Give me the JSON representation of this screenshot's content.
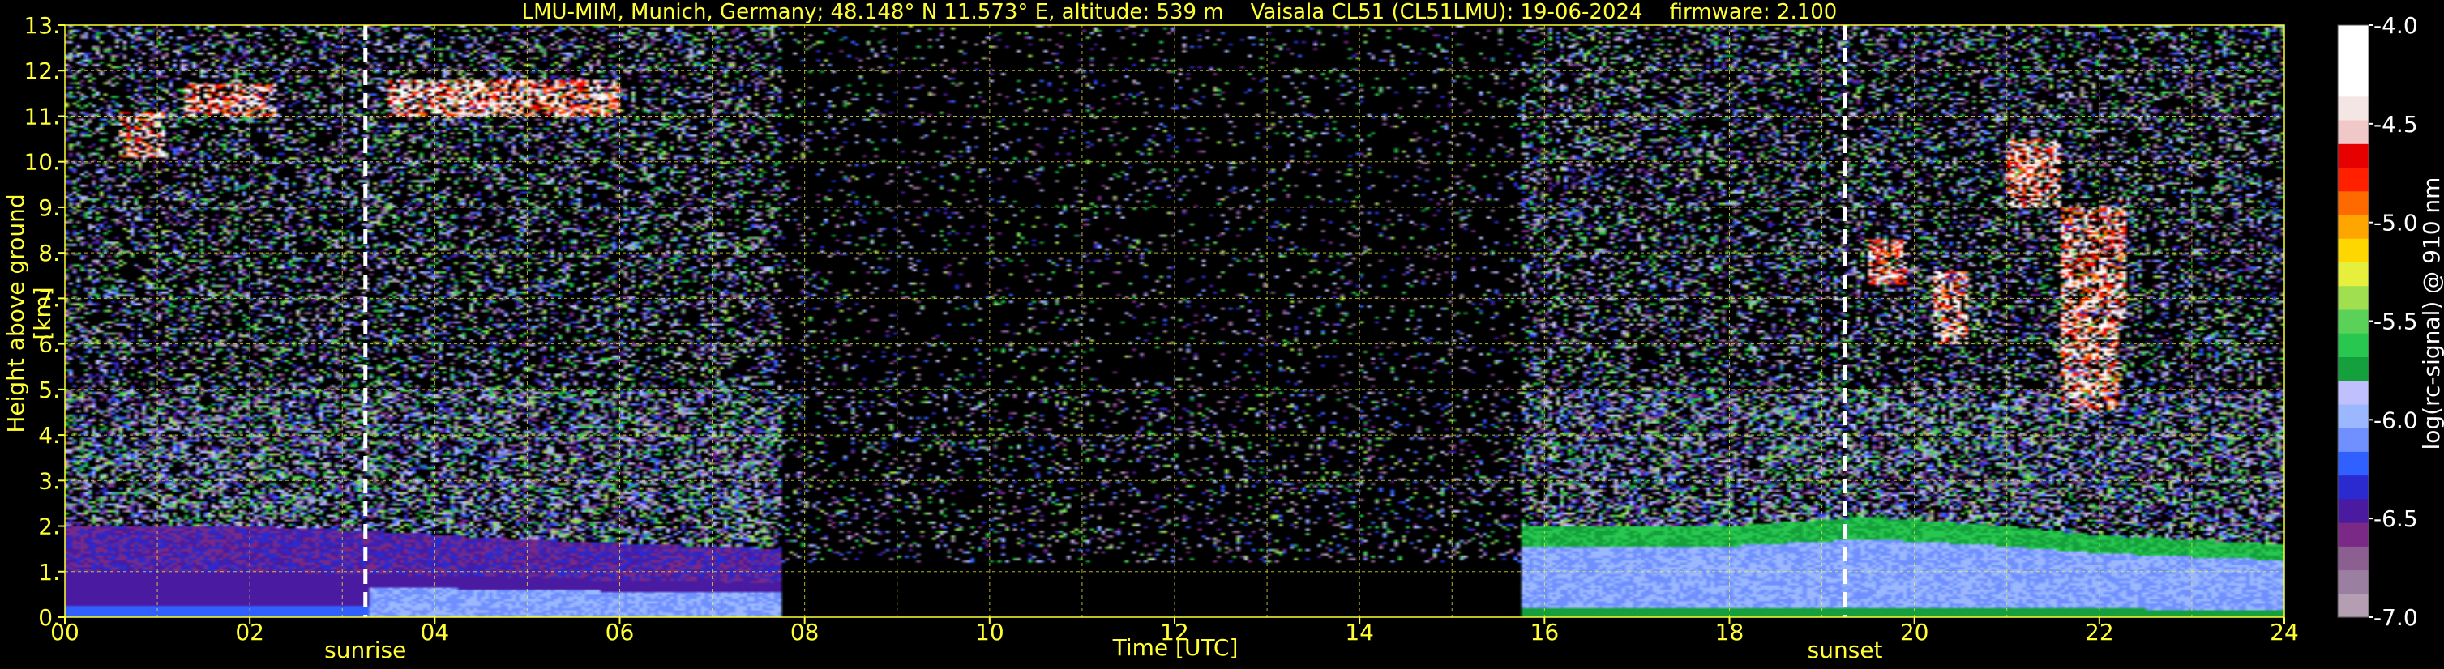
{
  "chart_data": {
    "type": "heatmap",
    "title": "LMU-MIM, Munich, Germany; 48.148° N 11.573° E, altitude: 539 m    Vaisala CL51 (CL51LMU): 19-06-2024    firmware: 2.100",
    "xlabel": "Time [UTC]",
    "ylabel": "Height above ground [km]",
    "xlim": [
      0,
      24
    ],
    "ylim": [
      0,
      13
    ],
    "x_ticks": [
      "00",
      "02",
      "04",
      "06",
      "08",
      "10",
      "12",
      "14",
      "16",
      "18",
      "20",
      "22",
      "24"
    ],
    "y_ticks": [
      "0.",
      "1.",
      "2.",
      "3.",
      "4.",
      "5.",
      "6.",
      "7.",
      "8.",
      "9.",
      "10.",
      "11.",
      "12.",
      "13."
    ],
    "grid": true,
    "colorbar": {
      "label": "log(rc-signal) @ 910 nm",
      "range": [
        -7.0,
        -4.0
      ],
      "ticks": [
        "-4.0",
        "-4.5",
        "-5.0",
        "-5.5",
        "-6.0",
        "-6.5",
        "-7.0"
      ]
    },
    "annotations": [
      {
        "label": "sunrise",
        "x": 3.25
      },
      {
        "label": "sunset",
        "x": 19.25
      }
    ],
    "missing_data_interval": [
      7.75,
      15.75
    ],
    "features": {
      "boundary_layer_top_km": [
        [
          0,
          2.0
        ],
        [
          2,
          2.0
        ],
        [
          3.25,
          1.9
        ],
        [
          5,
          1.7
        ],
        [
          7.7,
          1.5
        ],
        [
          15.8,
          2.0
        ],
        [
          18,
          2.0
        ],
        [
          19.5,
          2.2
        ],
        [
          21,
          2.0
        ],
        [
          22,
          1.8
        ],
        [
          23,
          1.7
        ],
        [
          24,
          1.6
        ]
      ],
      "cirrus_segments": [
        {
          "t0": 0.6,
          "t1": 1.1,
          "z0": 10.1,
          "z1": 11.1
        },
        {
          "t0": 1.3,
          "t1": 2.3,
          "z0": 11.0,
          "z1": 11.7
        },
        {
          "t0": 3.5,
          "t1": 6.0,
          "z0": 11.0,
          "z1": 11.8
        },
        {
          "t0": 19.5,
          "t1": 19.9,
          "z0": 7.3,
          "z1": 8.3
        },
        {
          "t0": 20.2,
          "t1": 20.6,
          "z0": 6.0,
          "z1": 7.6
        },
        {
          "t0": 21.0,
          "t1": 21.6,
          "z0": 9.0,
          "z1": 10.5
        },
        {
          "t0": 21.6,
          "t1": 22.2,
          "z0": 4.5,
          "z1": 9.0
        },
        {
          "t0": 22.2,
          "t1": 22.3,
          "z0": 6.5,
          "z1": 9.2
        }
      ]
    }
  },
  "colors": {
    "axis_text": "#ffff33",
    "grid": "#ffff33",
    "colorbar_text": "#ffffff",
    "background": "#000000",
    "colormap": [
      "#b49fb2",
      "#9a7fa0",
      "#8b5f8f",
      "#7a2a86",
      "#4a1aa0",
      "#2a2ad0",
      "#3060ff",
      "#7090ff",
      "#9bb8ff",
      "#c0c0ff",
      "#14a03c",
      "#28c850",
      "#5ad25a",
      "#a0e050",
      "#e6f03c",
      "#ffd700",
      "#ffa500",
      "#ff6a00",
      "#ff2000",
      "#e60000",
      "#f0c8c8",
      "#f5e6e6",
      "#ffffff",
      "#ffffff",
      "#ffffff"
    ]
  }
}
